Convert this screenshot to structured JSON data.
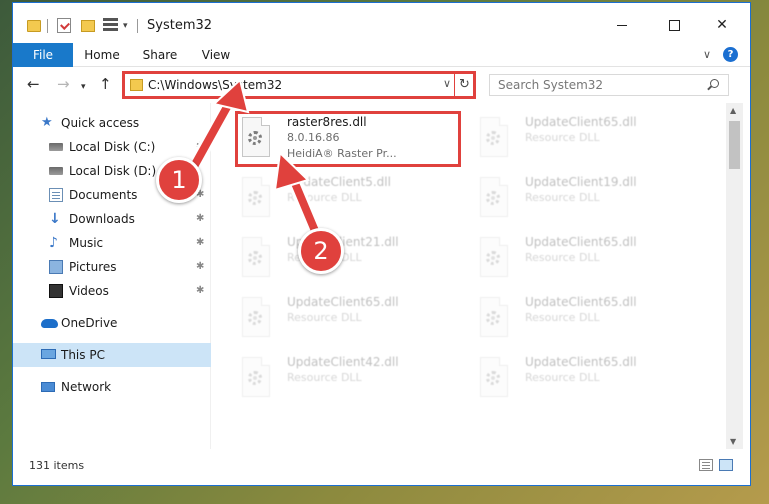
{
  "window": {
    "title": "System32",
    "minimize": "",
    "maximize": "",
    "close": "✕"
  },
  "ribbon": {
    "tabs": [
      {
        "label": "File"
      },
      {
        "label": "Home"
      },
      {
        "label": "Share"
      },
      {
        "label": "View"
      }
    ],
    "chevron": "∨",
    "help": "?"
  },
  "nav": {
    "back": "←",
    "forward": "→",
    "recent": "▾",
    "up": "↑"
  },
  "address": {
    "path": "C:\\Windows\\System32",
    "dropdown": "∨",
    "refresh": "↻"
  },
  "search": {
    "placeholder": "Search System32"
  },
  "sidebar": {
    "items": [
      {
        "label": "Quick access",
        "icon": "star-icon",
        "icon_glyph": "★"
      },
      {
        "label": "Local Disk (C:)",
        "icon": "drive-icon",
        "pin": "✱"
      },
      {
        "label": "Local Disk (D:)",
        "icon": "drive-icon"
      },
      {
        "label": "Documents",
        "icon": "documents-icon",
        "pin": "✱"
      },
      {
        "label": "Downloads",
        "icon": "download-arrow-icon",
        "icon_glyph": "↓",
        "pin": "✱"
      },
      {
        "label": "Music",
        "icon": "music-note-icon",
        "icon_glyph": "♪",
        "pin": "✱"
      },
      {
        "label": "Pictures",
        "icon": "pictures-icon",
        "pin": "✱"
      },
      {
        "label": "Videos",
        "icon": "videos-icon",
        "pin": "✱"
      },
      {
        "label": "OneDrive",
        "icon": "cloud-icon"
      },
      {
        "label": "This PC",
        "icon": "computer-icon",
        "selected": true
      },
      {
        "label": "Network",
        "icon": "network-icon"
      }
    ]
  },
  "files": [
    {
      "name": "raster8res.dll",
      "line2": "8.0.16.86",
      "line3": "HeidiA® Raster Pr...",
      "highlighted": true
    },
    {
      "name": "UpdateClient65.dll",
      "line2": "Resource DLL"
    },
    {
      "name": "UpdateClient5.dll",
      "line2": "Resource DLL"
    },
    {
      "name": "UpdateClient19.dll",
      "line2": "Resource DLL"
    },
    {
      "name": "UpdateClient21.dll",
      "line2": "Resource DLL"
    },
    {
      "name": "UpdateClient65.dll",
      "line2": "Resource DLL"
    },
    {
      "name": "UpdateClient65.dll",
      "line2": "Resource DLL"
    },
    {
      "name": "UpdateClient65.dll",
      "line2": "Resource DLL"
    },
    {
      "name": "UpdateClient42.dll",
      "line2": "Resource DLL"
    },
    {
      "name": "UpdateClient65.dll",
      "line2": "Resource DLL"
    }
  ],
  "status": {
    "item_count": "131 items"
  },
  "annotations": {
    "badge1": "1",
    "badge2": "2"
  },
  "colors": {
    "accent": "#1979ca",
    "highlight_red": "#e0413d",
    "selected_bg": "#cce4f7"
  }
}
